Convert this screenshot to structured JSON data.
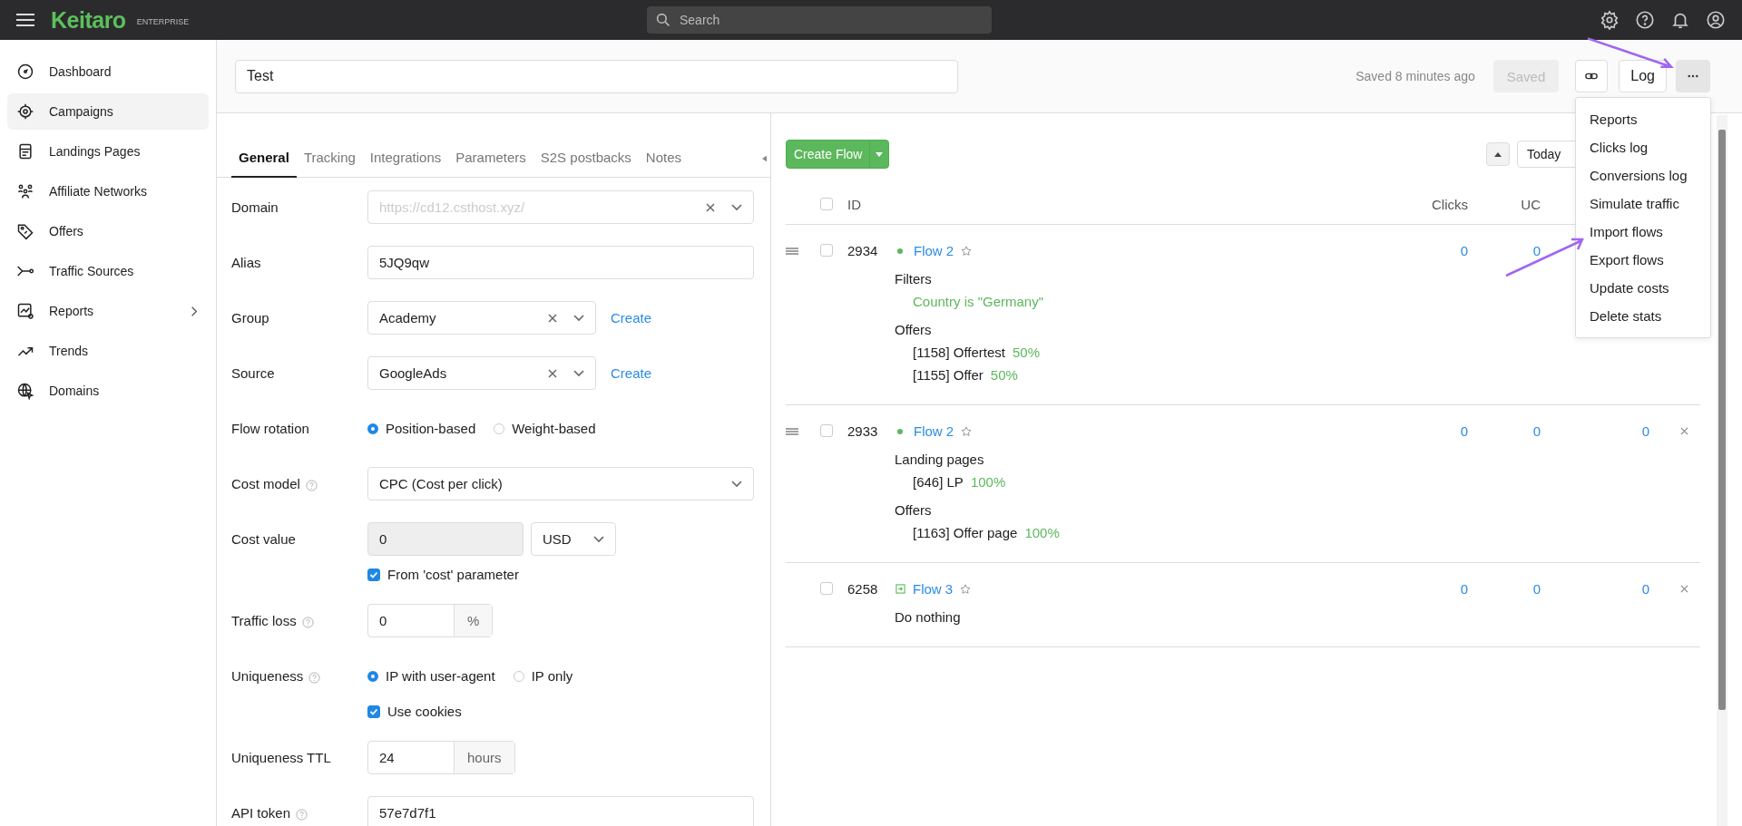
{
  "app": {
    "logo": "Keitaro",
    "edition": "ENTERPRISE",
    "search_placeholder": "Search"
  },
  "sidebar": {
    "items": [
      {
        "label": "Dashboard",
        "selected": false,
        "has_submenu": false
      },
      {
        "label": "Campaigns",
        "selected": true,
        "has_submenu": false
      },
      {
        "label": "Landings Pages",
        "selected": false,
        "has_submenu": false
      },
      {
        "label": "Affiliate Networks",
        "selected": false,
        "has_submenu": false
      },
      {
        "label": "Offers",
        "selected": false,
        "has_submenu": false
      },
      {
        "label": "Traffic Sources",
        "selected": false,
        "has_submenu": false
      },
      {
        "label": "Reports",
        "selected": false,
        "has_submenu": true
      },
      {
        "label": "Trends",
        "selected": false,
        "has_submenu": false
      },
      {
        "label": "Domains",
        "selected": false,
        "has_submenu": false
      }
    ]
  },
  "campaign": {
    "name": "Test",
    "saved_info": "Saved 8 minutes ago",
    "saved_button": {
      "label": "Saved",
      "disabled": true
    },
    "log_button": "Log"
  },
  "tabs": [
    {
      "label": "General",
      "selected": true
    },
    {
      "label": "Tracking",
      "selected": false
    },
    {
      "label": "Integrations",
      "selected": false
    },
    {
      "label": "Parameters",
      "selected": false
    },
    {
      "label": "S2S postbacks",
      "selected": false
    },
    {
      "label": "Notes",
      "selected": false
    }
  ],
  "form": [
    {
      "kind": "select",
      "label": "Domain",
      "help": false,
      "value": "https://cd12.csthost.xyz/",
      "muted": true,
      "clearable": true,
      "wide": true
    },
    {
      "kind": "text",
      "label": "Alias",
      "help": false,
      "value": "5JQ9qw"
    },
    {
      "kind": "select",
      "label": "Group",
      "help": false,
      "value": "Academy",
      "muted": false,
      "clearable": true,
      "wide": false,
      "link": "Create"
    },
    {
      "kind": "select",
      "label": "Source",
      "help": false,
      "value": "GoogleAds",
      "muted": false,
      "clearable": true,
      "wide": false,
      "link": "Create"
    },
    {
      "kind": "radio",
      "label": "Flow rotation",
      "help": false,
      "options": [
        {
          "label": "Position-based",
          "selected": true
        },
        {
          "label": "Weight-based",
          "selected": false
        }
      ]
    },
    {
      "kind": "select",
      "label": "Cost model",
      "help": true,
      "value": "CPC (Cost per click)",
      "muted": false,
      "clearable": false,
      "wide": true
    },
    {
      "kind": "cost",
      "label": "Cost value",
      "help": false,
      "value": "0",
      "disabled": true,
      "currency": "USD",
      "checkbox": {
        "label": "From 'cost' parameter",
        "checked": true
      }
    },
    {
      "kind": "addon",
      "label": "Traffic loss",
      "help": true,
      "value": "0",
      "unit": "%"
    },
    {
      "kind": "radio",
      "label": "Uniqueness",
      "help": true,
      "options": [
        {
          "label": "IP with user-agent",
          "selected": true
        },
        {
          "label": "IP only",
          "selected": false
        }
      ],
      "checkbox": {
        "label": "Use cookies",
        "checked": true
      }
    },
    {
      "kind": "addon",
      "label": "Uniqueness TTL",
      "help": false,
      "value": "24",
      "unit": "hours"
    },
    {
      "kind": "text",
      "label": "API token",
      "help": true,
      "value": "57e7d7f1"
    }
  ],
  "flows": {
    "create_button": "Create Flow",
    "period": "Today",
    "all_checked": false,
    "columns": [
      "ID",
      "Clicks",
      "UC"
    ],
    "rows": [
      {
        "id": "2934",
        "checked": false,
        "draggable": true,
        "kind": "dot",
        "name": "Flow 2",
        "sections": [
          {
            "title": "Filters",
            "items": [
              {
                "kind": "condition",
                "text": "Country is \"Germany\""
              }
            ]
          },
          {
            "title": "Offers",
            "items": [
              {
                "kind": "target",
                "text": "[1158] Offertest",
                "share": "50%"
              },
              {
                "kind": "target",
                "text": "[1155] Offer",
                "share": "50%"
              }
            ]
          }
        ],
        "values": [
          "0",
          "0"
        ],
        "removable": false
      },
      {
        "id": "2933",
        "checked": false,
        "draggable": true,
        "kind": "dot",
        "name": "Flow 2",
        "sections": [
          {
            "title": "Landing pages",
            "items": [
              {
                "kind": "target",
                "text": "[646] LP",
                "share": "100%"
              }
            ]
          },
          {
            "title": "Offers",
            "items": [
              {
                "kind": "target",
                "text": "[1163] Offer page",
                "share": "100%"
              }
            ]
          }
        ],
        "values": [
          "0",
          "0",
          "0"
        ],
        "removable": true
      },
      {
        "id": "6258",
        "checked": false,
        "draggable": false,
        "kind": "redirect",
        "name": "Flow 3",
        "sections": [
          {
            "title": "Do nothing"
          }
        ],
        "values": [
          "0",
          "0",
          "0"
        ],
        "removable": true
      }
    ]
  },
  "menu": [
    "Reports",
    "Clicks log",
    "Conversions log",
    "Simulate traffic",
    "Import flows",
    "Export flows",
    "Update costs",
    "Delete stats"
  ]
}
